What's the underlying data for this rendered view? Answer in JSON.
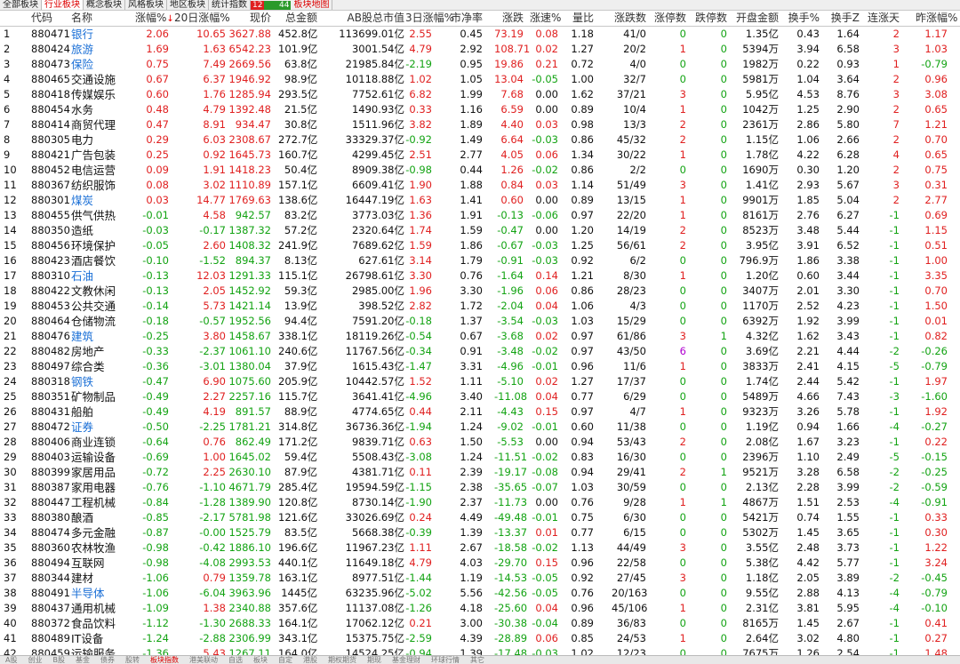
{
  "tabs": [
    {
      "label": "全部板块",
      "active": false
    },
    {
      "label": "行业板块",
      "active": true
    },
    {
      "label": "概念板块",
      "active": false
    },
    {
      "label": "风格板块",
      "active": false
    },
    {
      "label": "地区板块",
      "active": false
    },
    {
      "label": "统计指数",
      "active": false
    }
  ],
  "updown": {
    "up": "12",
    "down": "44"
  },
  "map_tab": "板块地图",
  "columns": {
    "num": "",
    "code": "代码",
    "name": "名称",
    "chg": "涨幅%",
    "sort_mark": "↓",
    "chg20": "20日涨幅%",
    "price": "现价",
    "amount": "总金额",
    "ab_mktcap": "AB股总市值",
    "chg3": "3日涨幅%",
    "pb": "市净率",
    "speed_val": "涨跌",
    "speed": "涨速%",
    "vol_ratio": "量比",
    "updown": "涨跌数",
    "limitup": "涨停数",
    "limitdown": "跌停数",
    "open_amt": "开盘金额",
    "turnover": "换手%",
    "turnover_z": "换手Z",
    "streak": "连涨天",
    "prev_chg": "昨涨幅%"
  },
  "rows": [
    [
      "1",
      "880471",
      "银行",
      true,
      "2.06",
      "10.65",
      "3627.88",
      "452.8亿",
      "113699.01亿",
      "2.55",
      "0.45",
      "73.19",
      "0.08",
      "1.18",
      "41/0",
      "0",
      "0",
      "1.35亿",
      "0.43",
      "1.64",
      "2",
      "1.17"
    ],
    [
      "2",
      "880424",
      "旅游",
      true,
      "1.69",
      "1.63",
      "6542.23",
      "101.9亿",
      "3001.54亿",
      "4.79",
      "2.92",
      "108.71",
      "0.02",
      "1.27",
      "20/2",
      "1",
      "0",
      "5394万",
      "3.94",
      "6.58",
      "3",
      "1.03"
    ],
    [
      "3",
      "880473",
      "保险",
      true,
      "0.75",
      "7.49",
      "2669.56",
      "63.8亿",
      "21985.84亿",
      "-2.19",
      "0.95",
      "19.86",
      "0.21",
      "0.72",
      "4/0",
      "0",
      "0",
      "1982万",
      "0.22",
      "0.93",
      "1",
      "-0.79"
    ],
    [
      "4",
      "880465",
      "交通设施",
      false,
      "0.67",
      "6.37",
      "1946.92",
      "98.9亿",
      "10118.88亿",
      "1.02",
      "1.05",
      "13.04",
      "-0.05",
      "1.00",
      "32/7",
      "0",
      "0",
      "5981万",
      "1.04",
      "3.64",
      "2",
      "0.96"
    ],
    [
      "5",
      "880418",
      "传媒娱乐",
      false,
      "0.60",
      "1.76",
      "1285.94",
      "293.5亿",
      "7752.61亿",
      "6.82",
      "1.99",
      "7.68",
      "0.00",
      "1.62",
      "37/21",
      "3",
      "0",
      "5.95亿",
      "4.53",
      "8.76",
      "3",
      "3.08"
    ],
    [
      "6",
      "880454",
      "水务",
      false,
      "0.48",
      "4.79",
      "1392.48",
      "21.5亿",
      "1490.93亿",
      "0.33",
      "1.16",
      "6.59",
      "0.00",
      "0.89",
      "10/4",
      "1",
      "0",
      "1042万",
      "1.25",
      "2.90",
      "2",
      "0.65"
    ],
    [
      "7",
      "880414",
      "商贸代理",
      false,
      "0.47",
      "8.91",
      "934.47",
      "30.8亿",
      "1511.96亿",
      "3.82",
      "1.89",
      "4.40",
      "0.03",
      "0.98",
      "13/3",
      "2",
      "0",
      "2361万",
      "2.86",
      "5.80",
      "7",
      "1.21"
    ],
    [
      "8",
      "880305",
      "电力",
      false,
      "0.29",
      "6.03",
      "2308.67",
      "272.7亿",
      "33329.37亿",
      "-0.92",
      "1.49",
      "6.64",
      "-0.03",
      "0.86",
      "45/32",
      "2",
      "0",
      "1.15亿",
      "1.06",
      "2.66",
      "2",
      "0.70"
    ],
    [
      "9",
      "880421",
      "广告包装",
      false,
      "0.25",
      "0.92",
      "1645.73",
      "160.7亿",
      "4299.45亿",
      "2.51",
      "2.77",
      "4.05",
      "0.06",
      "1.34",
      "30/22",
      "1",
      "0",
      "1.78亿",
      "4.22",
      "6.28",
      "4",
      "0.65"
    ],
    [
      "10",
      "880452",
      "电信运营",
      false,
      "0.09",
      "1.91",
      "1418.23",
      "50.4亿",
      "8909.38亿",
      "-0.98",
      "0.44",
      "1.26",
      "-0.02",
      "0.86",
      "2/2",
      "0",
      "0",
      "1690万",
      "0.30",
      "1.20",
      "2",
      "0.75"
    ],
    [
      "11",
      "880367",
      "纺织服饰",
      false,
      "0.08",
      "3.02",
      "1110.89",
      "157.1亿",
      "6609.41亿",
      "1.90",
      "1.88",
      "0.84",
      "0.03",
      "1.14",
      "51/49",
      "3",
      "0",
      "1.41亿",
      "2.93",
      "5.67",
      "3",
      "0.31"
    ],
    [
      "12",
      "880301",
      "煤炭",
      true,
      "0.03",
      "14.77",
      "1769.63",
      "138.6亿",
      "16447.19亿",
      "1.63",
      "1.41",
      "0.60",
      "0.00",
      "0.89",
      "13/15",
      "1",
      "0",
      "9901万",
      "1.85",
      "5.04",
      "2",
      "2.77"
    ],
    [
      "13",
      "880455",
      "供气供热",
      false,
      "-0.01",
      "4.58",
      "942.57",
      "83.2亿",
      "3773.03亿",
      "1.36",
      "1.91",
      "-0.13",
      "-0.06",
      "0.97",
      "22/20",
      "1",
      "0",
      "8161万",
      "2.76",
      "6.27",
      "-1",
      "0.69"
    ],
    [
      "14",
      "880350",
      "造纸",
      false,
      "-0.03",
      "-0.17",
      "1387.32",
      "57.2亿",
      "2320.64亿",
      "1.74",
      "1.59",
      "-0.47",
      "0.00",
      "1.20",
      "14/19",
      "2",
      "0",
      "8523万",
      "3.48",
      "5.44",
      "-1",
      "1.15"
    ],
    [
      "15",
      "880456",
      "环境保护",
      false,
      "-0.05",
      "2.60",
      "1408.32",
      "241.9亿",
      "7689.62亿",
      "1.59",
      "1.86",
      "-0.67",
      "-0.03",
      "1.25",
      "56/61",
      "2",
      "0",
      "3.95亿",
      "3.91",
      "6.52",
      "-1",
      "0.51"
    ],
    [
      "16",
      "880423",
      "酒店餐饮",
      false,
      "-0.10",
      "-1.52",
      "894.37",
      "8.13亿",
      "627.61亿",
      "3.14",
      "1.79",
      "-0.91",
      "-0.03",
      "0.92",
      "6/2",
      "0",
      "0",
      "796.9万",
      "1.86",
      "3.38",
      "-1",
      "1.00"
    ],
    [
      "17",
      "880310",
      "石油",
      true,
      "-0.13",
      "12.03",
      "1291.33",
      "115.1亿",
      "26798.61亿",
      "3.30",
      "0.76",
      "-1.64",
      "0.14",
      "1.21",
      "8/30",
      "1",
      "0",
      "1.20亿",
      "0.60",
      "3.44",
      "-1",
      "3.35"
    ],
    [
      "18",
      "880422",
      "文教休闲",
      false,
      "-0.13",
      "2.05",
      "1452.92",
      "59.3亿",
      "2985.00亿",
      "1.96",
      "3.30",
      "-1.96",
      "0.06",
      "0.86",
      "28/23",
      "0",
      "0",
      "3407万",
      "2.01",
      "3.30",
      "-1",
      "0.70"
    ],
    [
      "19",
      "880453",
      "公共交通",
      false,
      "-0.14",
      "5.73",
      "1421.14",
      "13.9亿",
      "398.52亿",
      "2.82",
      "1.72",
      "-2.04",
      "0.04",
      "1.06",
      "4/3",
      "0",
      "0",
      "1170万",
      "2.52",
      "4.23",
      "-1",
      "1.50"
    ],
    [
      "20",
      "880464",
      "仓储物流",
      false,
      "-0.18",
      "-0.57",
      "1952.56",
      "94.4亿",
      "7591.20亿",
      "-0.18",
      "1.37",
      "-3.54",
      "-0.03",
      "1.03",
      "15/29",
      "0",
      "0",
      "6392万",
      "1.92",
      "3.99",
      "-1",
      "0.01"
    ],
    [
      "21",
      "880476",
      "建筑",
      true,
      "-0.25",
      "3.80",
      "1458.67",
      "338.1亿",
      "18119.26亿",
      "-0.54",
      "0.67",
      "-3.68",
      "0.02",
      "0.97",
      "61/86",
      "3",
      "1",
      "4.32亿",
      "1.62",
      "3.43",
      "-1",
      "0.82"
    ],
    [
      "22",
      "880482",
      "房地产",
      false,
      "-0.33",
      "-2.37",
      "1061.10",
      "240.6亿",
      "11767.56亿",
      "-0.34",
      "0.91",
      "-3.48",
      "-0.02",
      "0.97",
      "43/50",
      "6",
      "0",
      "3.69亿",
      "2.21",
      "4.44",
      "-2",
      "-0.26"
    ],
    [
      "23",
      "880497",
      "综合类",
      false,
      "-0.36",
      "-3.01",
      "1380.04",
      "37.9亿",
      "1615.43亿",
      "-1.47",
      "3.31",
      "-4.96",
      "-0.01",
      "0.96",
      "11/6",
      "1",
      "0",
      "3833万",
      "2.41",
      "4.15",
      "-5",
      "-0.79"
    ],
    [
      "24",
      "880318",
      "钢铁",
      true,
      "-0.47",
      "6.90",
      "1075.60",
      "205.9亿",
      "10442.57亿",
      "1.52",
      "1.11",
      "-5.10",
      "0.02",
      "1.27",
      "17/37",
      "0",
      "0",
      "1.74亿",
      "2.44",
      "5.42",
      "-1",
      "1.97"
    ],
    [
      "25",
      "880351",
      "矿物制品",
      false,
      "-0.49",
      "2.27",
      "2257.16",
      "115.7亿",
      "3641.41亿",
      "-4.96",
      "3.40",
      "-11.08",
      "0.04",
      "0.77",
      "6/29",
      "0",
      "0",
      "5489万",
      "4.66",
      "7.43",
      "-3",
      "-1.60"
    ],
    [
      "26",
      "880431",
      "船舶",
      false,
      "-0.49",
      "4.19",
      "891.57",
      "88.9亿",
      "4774.65亿",
      "0.44",
      "2.11",
      "-4.43",
      "0.15",
      "0.97",
      "4/7",
      "1",
      "0",
      "9323万",
      "3.26",
      "5.78",
      "-1",
      "1.92"
    ],
    [
      "27",
      "880472",
      "证券",
      true,
      "-0.50",
      "-2.25",
      "1781.21",
      "314.8亿",
      "36736.36亿",
      "-1.94",
      "1.24",
      "-9.02",
      "-0.01",
      "0.60",
      "11/38",
      "0",
      "0",
      "1.19亿",
      "0.94",
      "1.66",
      "-4",
      "-0.27"
    ],
    [
      "28",
      "880406",
      "商业连锁",
      false,
      "-0.64",
      "0.76",
      "862.49",
      "171.2亿",
      "9839.71亿",
      "0.63",
      "1.50",
      "-5.53",
      "0.00",
      "0.94",
      "53/43",
      "2",
      "0",
      "2.08亿",
      "1.67",
      "3.23",
      "-1",
      "0.22"
    ],
    [
      "29",
      "880403",
      "运输设备",
      false,
      "-0.69",
      "1.00",
      "1645.02",
      "59.4亿",
      "5508.43亿",
      "-3.08",
      "1.24",
      "-11.51",
      "-0.02",
      "0.83",
      "16/30",
      "0",
      "0",
      "2396万",
      "1.10",
      "2.49",
      "-5",
      "-0.15"
    ],
    [
      "30",
      "880399",
      "家居用品",
      false,
      "-0.72",
      "2.25",
      "2630.10",
      "87.9亿",
      "4381.71亿",
      "0.11",
      "2.39",
      "-19.17",
      "-0.08",
      "0.94",
      "29/41",
      "2",
      "1",
      "9521万",
      "3.28",
      "6.58",
      "-2",
      "-0.25"
    ],
    [
      "31",
      "880387",
      "家用电器",
      false,
      "-0.76",
      "-1.10",
      "4671.79",
      "285.4亿",
      "19594.59亿",
      "-1.15",
      "2.38",
      "-35.65",
      "-0.07",
      "1.03",
      "30/59",
      "0",
      "0",
      "2.13亿",
      "2.28",
      "3.99",
      "-2",
      "-0.59"
    ],
    [
      "32",
      "880447",
      "工程机械",
      false,
      "-0.84",
      "-1.28",
      "1389.90",
      "120.8亿",
      "8730.14亿",
      "-1.90",
      "2.37",
      "-11.73",
      "0.00",
      "0.76",
      "9/28",
      "1",
      "1",
      "4867万",
      "1.51",
      "2.53",
      "-4",
      "-0.91"
    ],
    [
      "33",
      "880380",
      "酿酒",
      false,
      "-0.85",
      "-2.17",
      "5781.98",
      "121.6亿",
      "33026.69亿",
      "0.24",
      "4.49",
      "-49.48",
      "-0.01",
      "0.75",
      "6/30",
      "0",
      "0",
      "5421万",
      "0.74",
      "1.55",
      "-1",
      "0.33"
    ],
    [
      "34",
      "880474",
      "多元金融",
      false,
      "-0.87",
      "-0.00",
      "1525.79",
      "83.5亿",
      "5668.38亿",
      "-0.39",
      "1.39",
      "-13.37",
      "0.01",
      "0.77",
      "6/15",
      "0",
      "0",
      "5302万",
      "1.45",
      "3.65",
      "-1",
      "0.30"
    ],
    [
      "35",
      "880360",
      "农林牧渔",
      false,
      "-0.98",
      "-0.42",
      "1886.10",
      "196.6亿",
      "11967.23亿",
      "1.11",
      "2.67",
      "-18.58",
      "-0.02",
      "1.13",
      "44/49",
      "3",
      "0",
      "3.55亿",
      "2.48",
      "3.73",
      "-1",
      "1.22"
    ],
    [
      "36",
      "880494",
      "互联网",
      false,
      "-0.98",
      "-4.08",
      "2993.53",
      "440.1亿",
      "11649.18亿",
      "4.79",
      "4.03",
      "-29.70",
      "0.15",
      "0.96",
      "22/58",
      "0",
      "0",
      "5.38亿",
      "4.42",
      "5.77",
      "-1",
      "3.24"
    ],
    [
      "37",
      "880344",
      "建材",
      false,
      "-1.06",
      "0.79",
      "1359.78",
      "163.1亿",
      "8977.51亿",
      "-1.44",
      "1.19",
      "-14.53",
      "-0.05",
      "0.92",
      "27/45",
      "3",
      "0",
      "1.18亿",
      "2.05",
      "3.89",
      "-2",
      "-0.45"
    ],
    [
      "38",
      "880491",
      "半导体",
      true,
      "-1.06",
      "-6.04",
      "3963.96",
      "1445亿",
      "63235.96亿",
      "-5.02",
      "5.56",
      "-42.56",
      "-0.05",
      "0.76",
      "20/163",
      "0",
      "0",
      "9.55亿",
      "2.88",
      "4.13",
      "-4",
      "-0.79"
    ],
    [
      "39",
      "880437",
      "通用机械",
      false,
      "-1.09",
      "1.38",
      "2340.88",
      "357.6亿",
      "11137.08亿",
      "-1.26",
      "4.18",
      "-25.60",
      "0.04",
      "0.96",
      "45/106",
      "1",
      "0",
      "2.31亿",
      "3.81",
      "5.95",
      "-4",
      "-0.10"
    ],
    [
      "40",
      "880372",
      "食品饮料",
      false,
      "-1.12",
      "-1.30",
      "2688.33",
      "164.1亿",
      "17062.12亿",
      "0.21",
      "3.00",
      "-30.38",
      "-0.04",
      "0.89",
      "36/83",
      "0",
      "0",
      "8165万",
      "1.45",
      "2.67",
      "-1",
      "0.41"
    ],
    [
      "41",
      "880489",
      "IT设备",
      false,
      "-1.24",
      "-2.88",
      "2306.99",
      "343.1亿",
      "15375.75亿",
      "-2.59",
      "4.39",
      "-28.89",
      "0.06",
      "0.85",
      "24/53",
      "1",
      "0",
      "2.64亿",
      "3.02",
      "4.80",
      "-1",
      "0.27"
    ],
    [
      "42",
      "880459",
      "运输服务",
      false,
      "-1.36",
      "5.43",
      "1267.11",
      "164.0亿",
      "14524.25亿",
      "-0.94",
      "1.39",
      "-17.48",
      "-0.03",
      "1.02",
      "12/23",
      "0",
      "0",
      "7675万",
      "1.26",
      "2.54",
      "-1",
      "1.48"
    ]
  ],
  "colors": {
    "up": "#e02020",
    "down": "#13a313",
    "neutral": "#111111",
    "link": "#1a6fd6",
    "limitup_highlight": "#b000d0"
  },
  "bottom_tabs": [
    "A股",
    "创业",
    "B股",
    "基金",
    "债券",
    "股转",
    "板块指数",
    "港美联动",
    "自选",
    "板块",
    "自定",
    "港股",
    "期权期货",
    "期现",
    "基金理财",
    "环球行情",
    "其它"
  ]
}
